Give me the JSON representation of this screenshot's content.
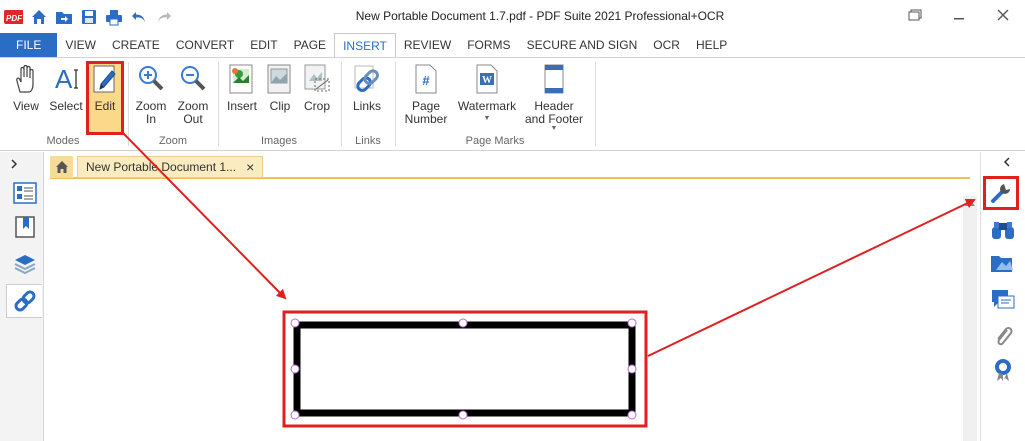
{
  "window": {
    "title": "New Portable Document 1.7.pdf   -   PDF Suite 2021  Professional+OCR",
    "app_logo": "PDF"
  },
  "quick_access": [
    "app-logo",
    "home-icon",
    "open-folder-icon",
    "save-icon",
    "print-icon",
    "undo-icon",
    "redo-icon"
  ],
  "menu": {
    "tabs": [
      "FILE",
      "VIEW",
      "CREATE",
      "CONVERT",
      "EDIT",
      "PAGE",
      "INSERT",
      "REVIEW",
      "FORMS",
      "SECURE AND SIGN",
      "OCR",
      "HELP"
    ],
    "active": "INSERT"
  },
  "ribbon": {
    "buttons": {
      "view": "View",
      "select": "Select",
      "edit": "Edit",
      "zoom_in": "Zoom In",
      "zoom_out": "Zoom Out",
      "insert": "Insert",
      "clip": "Clip",
      "crop": "Crop",
      "links": "Links",
      "page_number": "Page Number",
      "watermark": "Watermark",
      "header_footer": "Header and Footer"
    },
    "groups": {
      "modes": "Modes",
      "zoom": "Zoom",
      "images": "Images",
      "links": "Links",
      "page_marks": "Page Marks"
    }
  },
  "document_tab": {
    "label": "New Portable Document 1...",
    "close": "×"
  },
  "colors": {
    "accent": "#2b6dc4",
    "highlight_red": "#e01f1f",
    "edit_button_bg": "#fbd98a",
    "tab_bg": "#faebc1",
    "tab_underline": "#f0c15a"
  }
}
